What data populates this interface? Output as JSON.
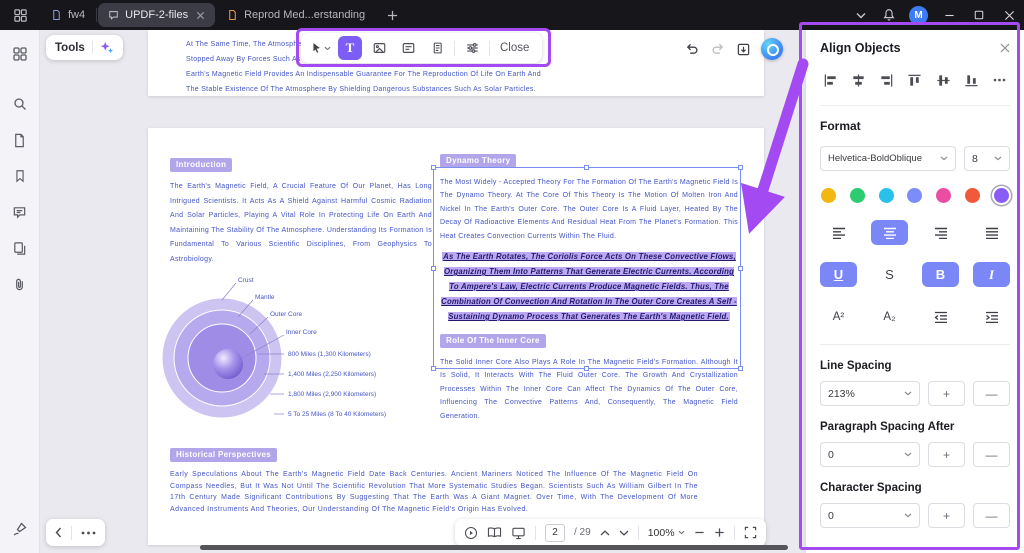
{
  "theme": {
    "accent": "#7c5df6",
    "annot": "#a44af2",
    "doc-text": "#4355c6",
    "hl": "#b3a5ea",
    "sel": "#bda9f2",
    "pactive": "#7b87f7"
  },
  "titlebar": {
    "tab1": "fw4",
    "tab2": "UPDF-2-files",
    "tab3": "Reprod Med...erstanding",
    "avatar_initial": "M"
  },
  "tools_button": {
    "label": "Tools"
  },
  "edit_toolbar": {
    "text_tool": "T",
    "close": "Close"
  },
  "doc": {
    "page1": {
      "line1": "At The Same Time, The Atmosphe",
      "line2": "Stopped Away By Forces Such As",
      "line3": "Earth's Magnetic Field Provides An Indispensable Guarantee For The Reproduction Of Life On Earth And",
      "line4": "The Stable Existence Of The Atmosphere By Shielding Dangerous Substances Such As Solar Particles."
    },
    "intro": {
      "heading": "Introduction",
      "body": "The Earth's Magnetic Field, A Crucial Feature Of Our Planet, Has Long Intrigued Scientists. It Acts As A Shield Against Harmful Cosmic Radiation And Solar Particles, Playing A Vital Role In Protecting Life On Earth And Maintaining The Stability Of The Atmosphere. Understanding Its Formation Is Fundamental To Various Scientific Disciplines, From Geophysics To Astrobiology."
    },
    "diagram": {
      "label_crust": "Crust",
      "label_mantle": "Mantle",
      "label_outer_core": "Outer Core",
      "label_inner_core": "Inner Core",
      "m1": "800 Miles (1,300 Kilometers)",
      "m2": "1,400 Miles (2,250 Kilometers)",
      "m3": "1,800 Miles (2,900 Kilometers)",
      "m4": "5 To 25 Miles (8 To 40 Kilometers)"
    },
    "dynamo": {
      "heading": "Dynamo Theory",
      "body": "The Most Widely - Accepted Theory For The Formation Of The Earth's Magnetic Field Is The Dynamo Theory. At The Core Of This Theory Is The Motion Of Molten Iron And Nickel In The Earth's Outer Core. The Outer Core Is A Fluid Layer, Heated By The Decay Of Radioactive Elements And Residual Heat From The Planet's Formation. This Heat Creates Convection Currents Within The Fluid.",
      "selected": "As The Earth Rotates, The Coriolis Force Acts On These Convective Flows, Organizing Them Into Patterns That Generate Electric Currents. According To Ampere's Law, Electric Currents Produce Magnetic Fields. Thus, The Combination Of Convection And Rotation In The Outer Core Creates A Self - Sustaining Dynamo Process That Generates The Earth's Magnetic Field."
    },
    "inner_core": {
      "heading": "Role Of The Inner Core",
      "body": "The Solid Inner Core Also Plays A Role In The Magnetic Field's Formation. Although It Is Solid, It Interacts With The Fluid Outer Core. The Growth And Crystallization Processes Within The Inner Core Can Affect The Dynamics Of The Outer Core, Influencing The Convective Patterns And, Consequently, The Magnetic Field Generation."
    },
    "historical": {
      "heading": "Historical Perspectives",
      "body": "Early Speculations About The Earth's Magnetic Field Date Back Centuries. Ancient Mariners Noticed The Influence Of The Magnetic Field On Compass Needles, But It Was Not Until The Scientific Revolution That More Systematic Studies Began. Scientists Such As William Gilbert In The 17th Century Made Significant Contributions By Suggesting That The Earth Was A Giant Magnet. Over Time, With The Development Of More Advanced Instruments And Theories, Our Understanding Of The Magnetic Field's Origin Has Evolved."
    }
  },
  "panel": {
    "title": "Align Objects",
    "format_label": "Format",
    "font_value": "Helvetica-BoldOblique",
    "font_size": "8",
    "colors": [
      "#f3b711",
      "#2ecc71",
      "#29c1ec",
      "#7c8cf8",
      "#eb4ea1",
      "#f0593a",
      "#8a5cf6"
    ],
    "underline": "U",
    "strikethrough": "S",
    "bold": "B",
    "italic": "I",
    "superscript": "A²",
    "subscript": "A₂",
    "line_spacing_label": "Line Spacing",
    "line_spacing_value": "213%",
    "para_spacing_label": "Paragraph Spacing After",
    "para_spacing_value": "0",
    "char_spacing_label": "Character Spacing",
    "char_spacing_value": "0",
    "plus": "+",
    "minus": "—"
  },
  "bottom": {
    "page_current": "2",
    "page_total": "/ 29",
    "zoom": "100%"
  }
}
